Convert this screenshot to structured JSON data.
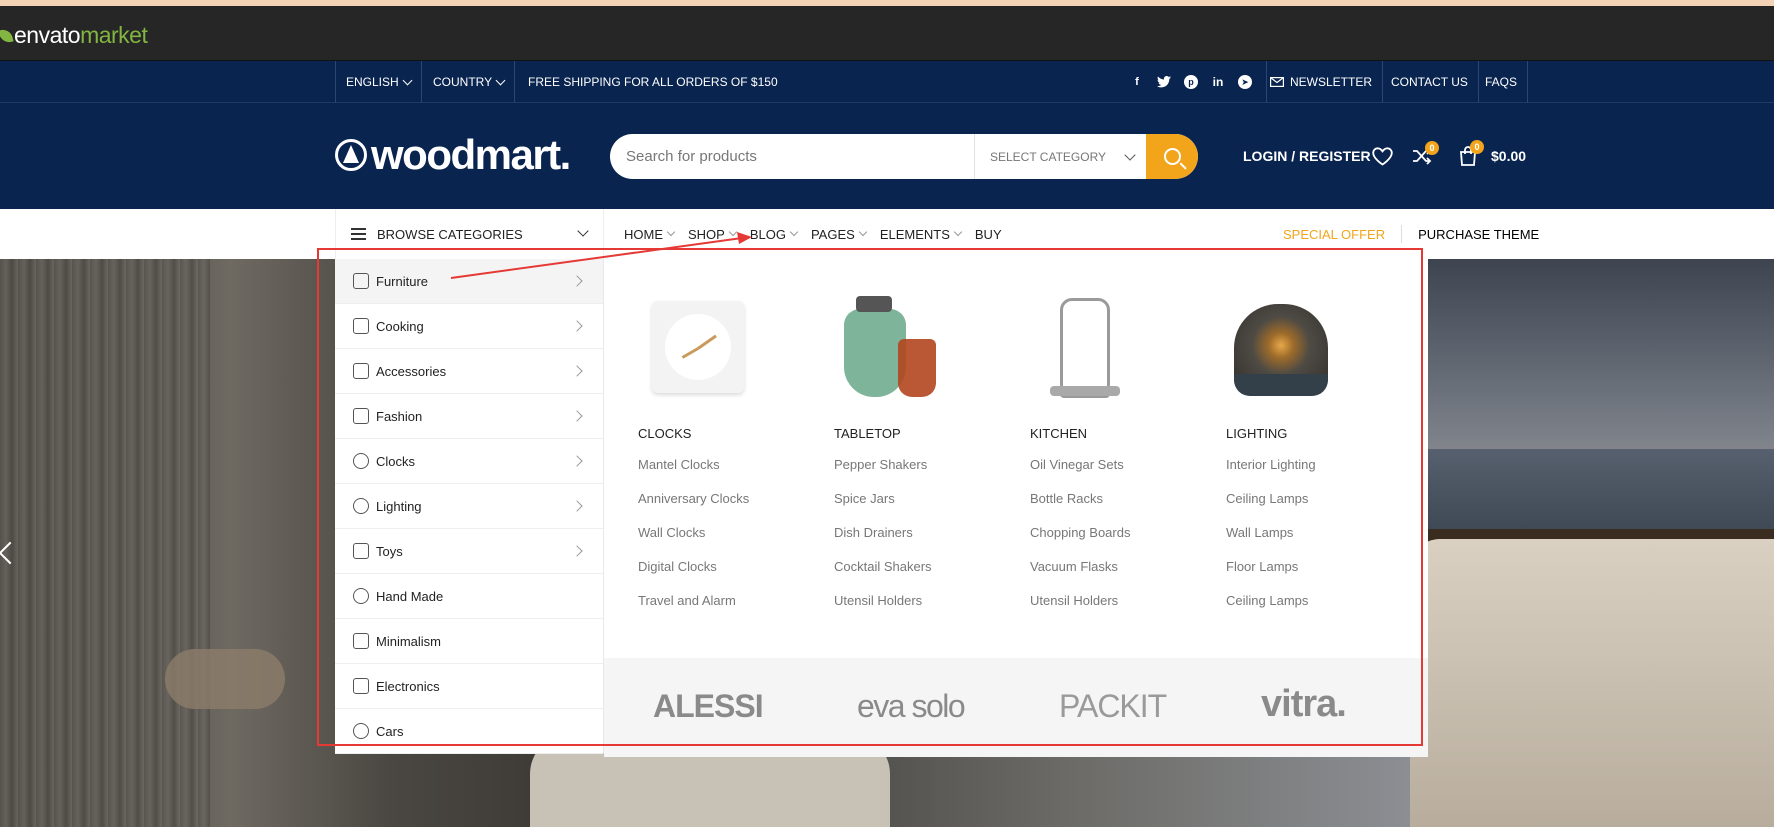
{
  "envato": {
    "brand": "envato",
    "market": "market"
  },
  "topbar": {
    "language": "ENGLISH",
    "country": "COUNTRY",
    "shipping": "FREE SHIPPING FOR ALL ORDERS OF $150",
    "social": [
      "facebook-icon",
      "twitter-icon",
      "pinterest-icon",
      "linkedin-icon",
      "telegram-icon"
    ],
    "newsletter": "NEWSLETTER",
    "contact": "CONTACT US",
    "faqs": "FAQS"
  },
  "header": {
    "logo": "woodmart.",
    "search_placeholder": "Search for products",
    "select_category": "SELECT CATEGORY",
    "login": "LOGIN / REGISTER",
    "compare_count": "0",
    "cart_count": "0",
    "cart_total": "$0.00"
  },
  "nav": {
    "browse": "BROWSE CATEGORIES",
    "items": [
      "HOME",
      "SHOP",
      "BLOG",
      "PAGES",
      "ELEMENTS",
      "BUY"
    ],
    "special_offer": "SPECIAL OFFER",
    "purchase": "PURCHASE THEME"
  },
  "categories": [
    "Furniture",
    "Cooking",
    "Accessories",
    "Fashion",
    "Clocks",
    "Lighting",
    "Toys",
    "Hand Made",
    "Minimalism",
    "Electronics",
    "Cars"
  ],
  "mega": {
    "columns": [
      {
        "title": "CLOCKS",
        "links": [
          "Mantel Clocks",
          "Anniversary Clocks",
          "Wall Clocks",
          "Digital Clocks",
          "Travel and Alarm"
        ]
      },
      {
        "title": "TABLETOP",
        "links": [
          "Pepper Shakers",
          "Spice Jars",
          "Dish Drainers",
          "Cocktail Shakers",
          "Utensil Holders"
        ]
      },
      {
        "title": "KITCHEN",
        "links": [
          "Oil Vinegar Sets",
          "Bottle Racks",
          "Chopping Boards",
          "Vacuum Flasks",
          "Utensil Holders"
        ]
      },
      {
        "title": "LIGHTING",
        "links": [
          "Interior Lighting",
          "Ceiling Lamps",
          "Wall Lamps",
          "Floor Lamps",
          "Ceiling Lamps"
        ]
      }
    ],
    "brands": [
      "ALESSI",
      "eva solo",
      "PACKIT",
      "vitra."
    ]
  },
  "colors": {
    "navy": "#0a2450",
    "accent": "#f2a51b",
    "annotation": "#e53935"
  }
}
